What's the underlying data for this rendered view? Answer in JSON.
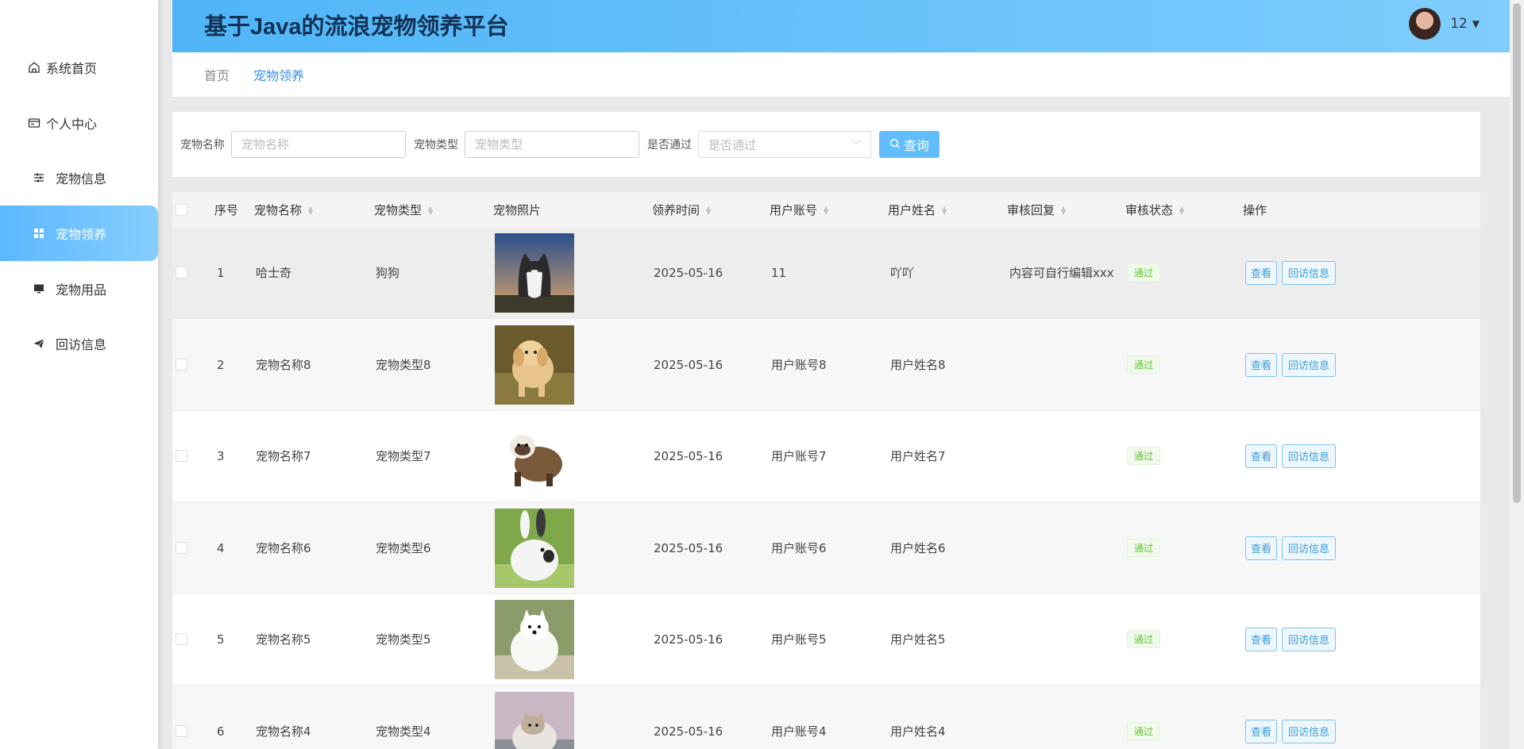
{
  "app": {
    "title": "基于Java的流浪宠物领养平台"
  },
  "user": {
    "name": "12"
  },
  "sidebar": {
    "items": [
      {
        "label": "系统首页",
        "icon": "home-icon"
      },
      {
        "label": "个人中心",
        "icon": "id-card-icon"
      },
      {
        "label": "宠物信息",
        "icon": "sliders-icon"
      },
      {
        "label": "宠物领养",
        "icon": "grid-icon",
        "active": true
      },
      {
        "label": "宠物用品",
        "icon": "monitor-icon"
      },
      {
        "label": "回访信息",
        "icon": "send-icon"
      }
    ]
  },
  "breadcrumb": {
    "home": "首页",
    "current": "宠物领养"
  },
  "search": {
    "name_label": "宠物名称",
    "name_placeholder": "宠物名称",
    "type_label": "宠物类型",
    "type_placeholder": "宠物类型",
    "pass_label": "是否通过",
    "pass_placeholder": "是否通过",
    "query_label": "查询"
  },
  "table": {
    "headers": {
      "index": "序号",
      "name": "宠物名称",
      "type": "宠物类型",
      "photo": "宠物照片",
      "time": "领养时间",
      "account": "用户账号",
      "username": "用户姓名",
      "reply": "审核回复",
      "status": "审核状态",
      "ops": "操作"
    },
    "rows": [
      {
        "index": "1",
        "name": "哈士奇",
        "type": "狗狗",
        "photo": "husky-photo",
        "time": "2025-05-16",
        "account": "11",
        "username": "吖吖",
        "reply": "内容可自行编辑xxx",
        "status": "通过",
        "view": "查看",
        "visit": "回访信息"
      },
      {
        "index": "2",
        "name": "宠物名称8",
        "type": "宠物类型8",
        "photo": "golden-puppy-photo",
        "time": "2025-05-16",
        "account": "用户账号8",
        "username": "用户姓名8",
        "reply": "",
        "status": "通过",
        "view": "查看",
        "visit": "回访信息"
      },
      {
        "index": "3",
        "name": "宠物名称7",
        "type": "宠物类型7",
        "photo": "ferret-photo",
        "time": "2025-05-16",
        "account": "用户账号7",
        "username": "用户姓名7",
        "reply": "",
        "status": "通过",
        "view": "查看",
        "visit": "回访信息"
      },
      {
        "index": "4",
        "name": "宠物名称6",
        "type": "宠物类型6",
        "photo": "rabbit-photo",
        "time": "2025-05-16",
        "account": "用户账号6",
        "username": "用户姓名6",
        "reply": "",
        "status": "通过",
        "view": "查看",
        "visit": "回访信息"
      },
      {
        "index": "5",
        "name": "宠物名称5",
        "type": "宠物类型5",
        "photo": "samoyed-photo",
        "time": "2025-05-16",
        "account": "用户账号5",
        "username": "用户姓名5",
        "reply": "",
        "status": "通过",
        "view": "查看",
        "visit": "回访信息"
      },
      {
        "index": "6",
        "name": "宠物名称4",
        "type": "宠物类型4",
        "photo": "cat-photo",
        "time": "2025-05-16",
        "account": "用户账号4",
        "username": "用户姓名4",
        "reply": "",
        "status": "通过",
        "view": "查看",
        "visit": "回访信息"
      }
    ]
  },
  "colors": {
    "accent": "#5cb8ff",
    "status_green": "#67c23a",
    "header_from": "#4fb5f7",
    "header_to": "#7fcdfd"
  }
}
